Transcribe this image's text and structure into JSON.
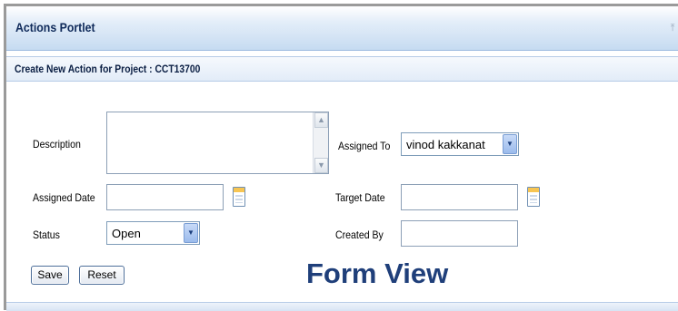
{
  "portlet": {
    "title": "Actions Portlet",
    "subheader": "Create New Action for Project : CCT13700"
  },
  "form": {
    "description_label": "Description",
    "description_value": "",
    "assigned_to_label": "Assigned To",
    "assigned_to_value": "vinod kakkanat",
    "assigned_date_label": "Assigned Date",
    "assigned_date_value": "",
    "target_date_label": "Target Date",
    "target_date_value": "",
    "status_label": "Status",
    "status_value": "Open",
    "created_by_label": "Created By",
    "created_by_value": ""
  },
  "buttons": {
    "save": "Save",
    "reset": "Reset"
  },
  "overlay": {
    "caption": "Form View"
  },
  "icons": {
    "header": "collapse-icon",
    "calendar": "calendar-icon",
    "dropdown": "chevron-down-icon",
    "scroll_up": "arrow-up-icon",
    "scroll_down": "arrow-down-icon"
  },
  "colors": {
    "accent": "#1f3f7a",
    "header_gradient_end": "#c6dbf1",
    "calendar_top": "#f7c552"
  }
}
